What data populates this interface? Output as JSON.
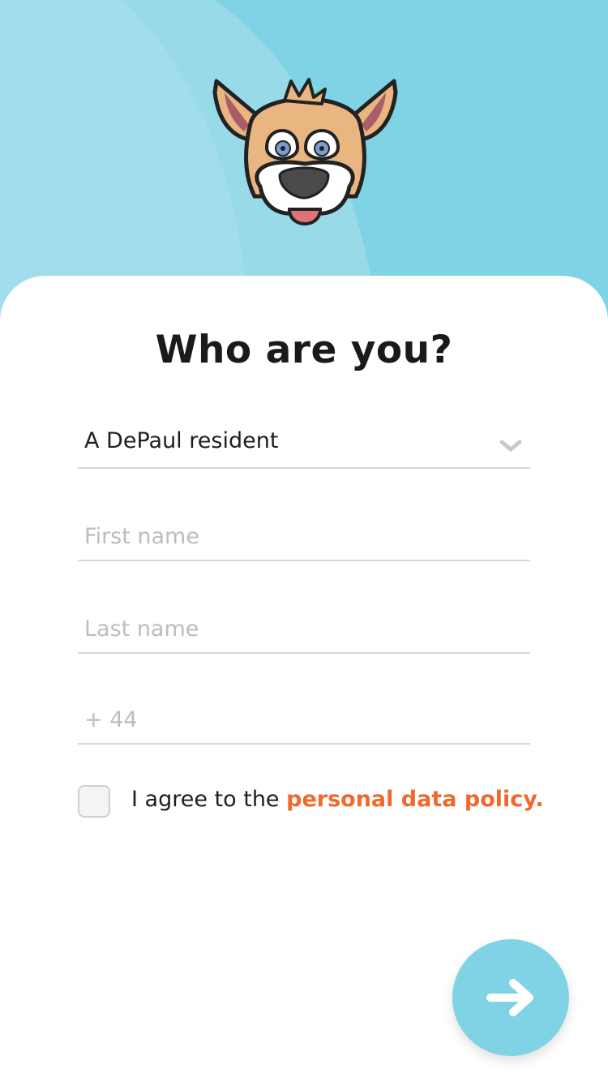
{
  "header": {
    "mascot": "dog-face-mascot",
    "colors": {
      "hero": "#7fd3e4",
      "accent": "#f0692c"
    }
  },
  "form": {
    "title": "Who are you?",
    "role_select": {
      "value": "A DePaul resident"
    },
    "first_name": {
      "placeholder": "First name",
      "value": ""
    },
    "last_name": {
      "placeholder": "Last name",
      "value": ""
    },
    "phone": {
      "placeholder": "+ 44",
      "value": ""
    },
    "consent": {
      "checked": false,
      "text": "I agree to the ",
      "link_text": "personal data policy."
    }
  },
  "actions": {
    "next_icon": "arrow-right-icon"
  }
}
